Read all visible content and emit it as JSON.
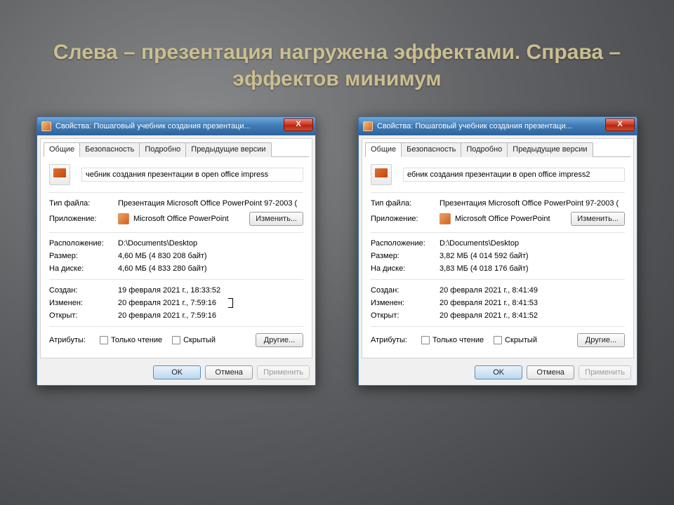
{
  "slide_title": "Слева – презентация нагружена эффектами. Справа – эффектов минимум",
  "dialog_title_prefix": "Свойства: Пошаговый учебник создания презентаци...",
  "close_glyph": "X",
  "tabs": {
    "general": "Общие",
    "security": "Безопасность",
    "details": "Подробно",
    "versions": "Предыдущие версии"
  },
  "labels": {
    "filetype": "Тип файла:",
    "application": "Приложение:",
    "change": "Изменить...",
    "location": "Расположение:",
    "size": "Размер:",
    "ondisk": "На диске:",
    "created": "Создан:",
    "modified": "Изменен:",
    "accessed": "Открыт:",
    "attributes": "Атрибуты:",
    "readonly": "Только чтение",
    "hidden": "Скрытый",
    "other": "Другие...",
    "ok": "OK",
    "cancel": "Отмена",
    "apply": "Применить"
  },
  "app_name": "Microsoft Office PowerPoint",
  "left": {
    "filename": "чебник создания презентации в open office impress",
    "filetype": "Презентация Microsoft Office PowerPoint 97-2003 (",
    "location": "D:\\Documents\\Desktop",
    "size": "4,60 МБ (4 830 208 байт)",
    "ondisk": "4,60 МБ (4 833 280 байт)",
    "created": "19 февраля 2021 г., 18:33:52",
    "modified": "20 февраля 2021 г., 7:59:16",
    "accessed": "20 февраля 2021 г., 7:59:16"
  },
  "right": {
    "filename": "ебник создания презентации в open office impress2",
    "filetype": "Презентация Microsoft Office PowerPoint 97-2003 (",
    "location": "D:\\Documents\\Desktop",
    "size": "3,82 МБ (4 014 592 байт)",
    "ondisk": "3,83 МБ (4 018 176 байт)",
    "created": "20 февраля 2021 г., 8:41:49",
    "modified": "20 февраля 2021 г., 8:41:53",
    "accessed": "20 февраля 2021 г., 8:41:52"
  }
}
